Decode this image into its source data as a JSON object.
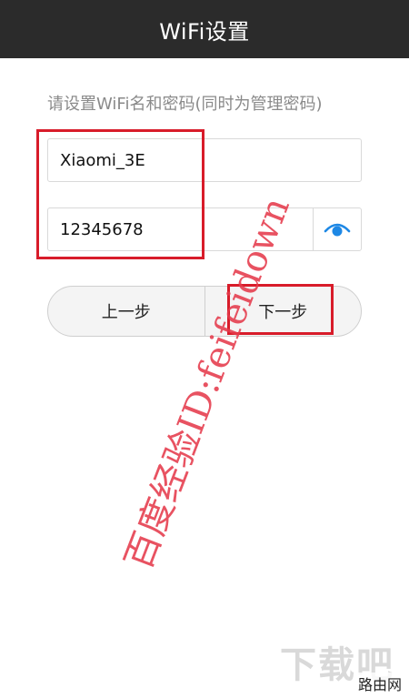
{
  "header": {
    "title": "WiFi设置"
  },
  "form": {
    "hint": "请设置WiFi名和密码(同时为管理密码)",
    "ssid_value": "Xiaomi_3E",
    "password_value": "12345678"
  },
  "buttons": {
    "prev_label": "上一步",
    "next_label": "下一步"
  },
  "icons": {
    "show_password": "eye-icon"
  },
  "colors": {
    "titlebar": "#2b2b2b",
    "accent": "#1e88e5",
    "annotation": "#d81c2a",
    "watermark": "#e53b4c"
  },
  "watermark": {
    "text": "百度经验ID:feifeidown"
  },
  "corner": {
    "logo": "下载吧",
    "site": "路由网"
  }
}
